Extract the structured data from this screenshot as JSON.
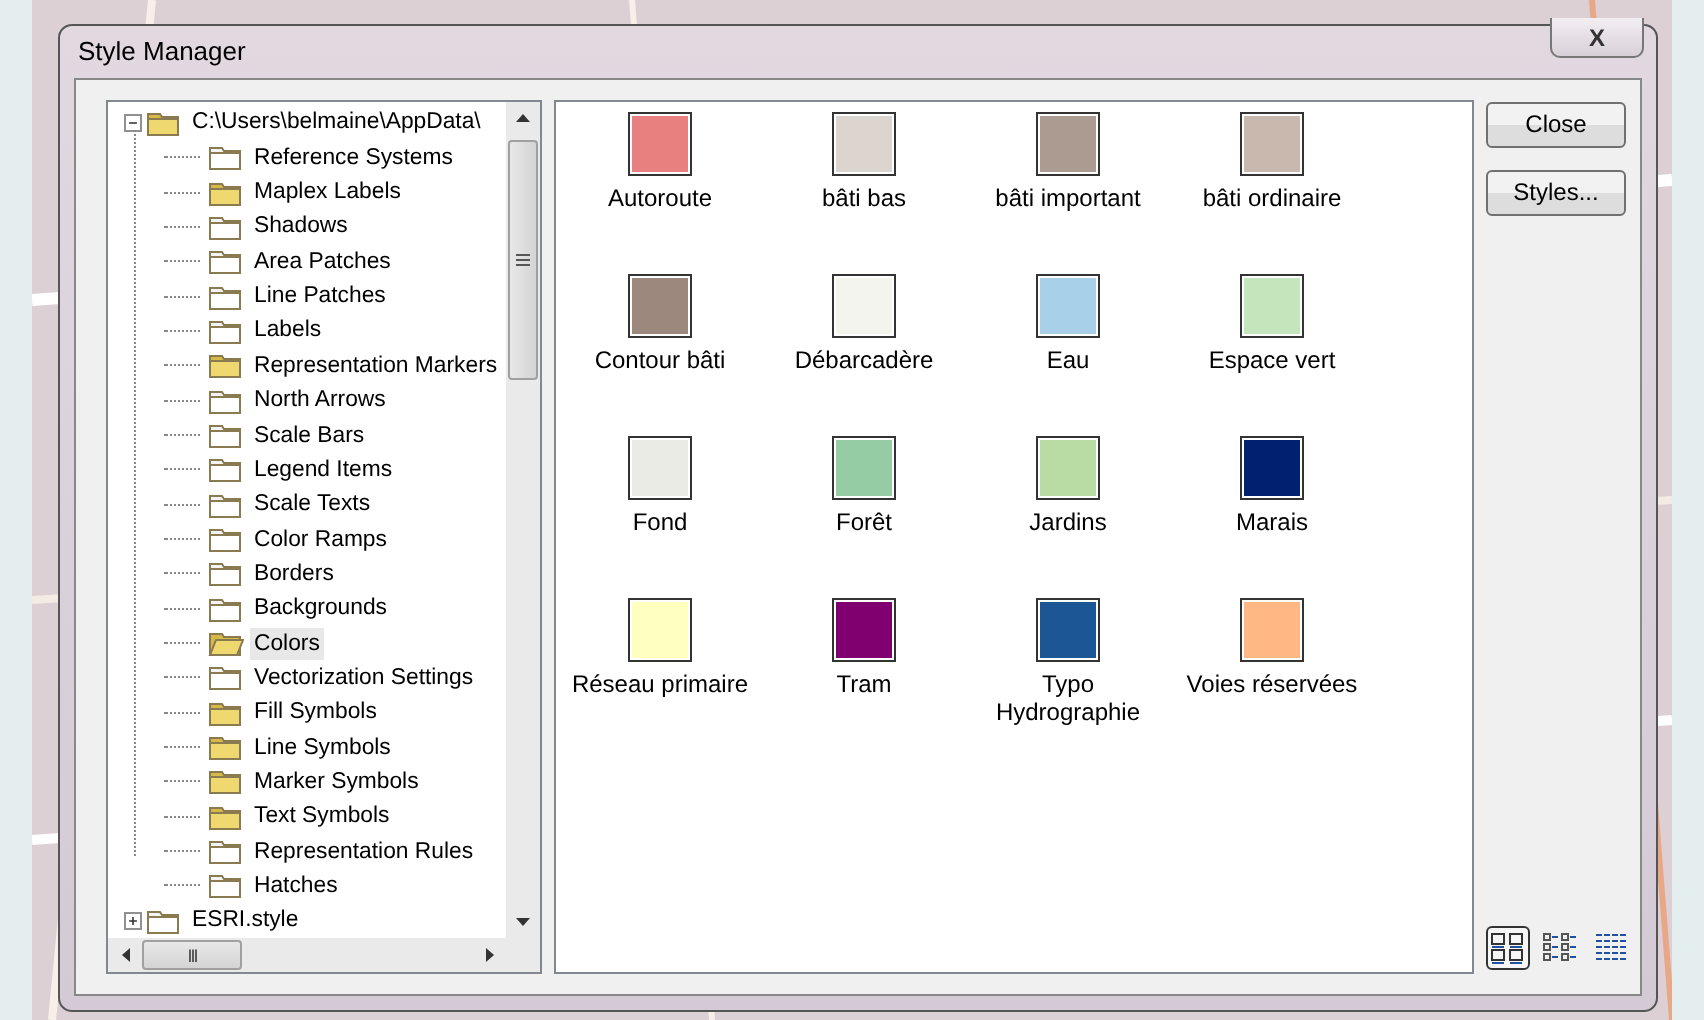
{
  "window": {
    "title": "Style Manager",
    "close_glyph": "X"
  },
  "tree": {
    "root": {
      "label": "C:\\Users\\belmaine\\AppData\\",
      "expanded": true,
      "has_items": true,
      "children": [
        {
          "label": "Reference Systems",
          "has_items": false,
          "selected": false
        },
        {
          "label": "Maplex Labels",
          "has_items": true,
          "selected": false
        },
        {
          "label": "Shadows",
          "has_items": false,
          "selected": false
        },
        {
          "label": "Area Patches",
          "has_items": false,
          "selected": false
        },
        {
          "label": "Line Patches",
          "has_items": false,
          "selected": false
        },
        {
          "label": "Labels",
          "has_items": false,
          "selected": false
        },
        {
          "label": "Representation Markers",
          "has_items": true,
          "selected": false
        },
        {
          "label": "North Arrows",
          "has_items": false,
          "selected": false
        },
        {
          "label": "Scale Bars",
          "has_items": false,
          "selected": false
        },
        {
          "label": "Legend Items",
          "has_items": false,
          "selected": false
        },
        {
          "label": "Scale Texts",
          "has_items": false,
          "selected": false
        },
        {
          "label": "Color Ramps",
          "has_items": false,
          "selected": false
        },
        {
          "label": "Borders",
          "has_items": false,
          "selected": false
        },
        {
          "label": "Backgrounds",
          "has_items": false,
          "selected": false
        },
        {
          "label": "Colors",
          "has_items": true,
          "selected": true
        },
        {
          "label": "Vectorization Settings",
          "has_items": false,
          "selected": false
        },
        {
          "label": "Fill Symbols",
          "has_items": true,
          "selected": false
        },
        {
          "label": "Line Symbols",
          "has_items": true,
          "selected": false
        },
        {
          "label": "Marker Symbols",
          "has_items": true,
          "selected": false
        },
        {
          "label": "Text Symbols",
          "has_items": true,
          "selected": false
        },
        {
          "label": "Representation Rules",
          "has_items": false,
          "selected": false
        },
        {
          "label": "Hatches",
          "has_items": false,
          "selected": false
        }
      ]
    },
    "next": {
      "label": "ESRI.style",
      "expanded": false
    }
  },
  "colors": [
    {
      "name": "Autoroute",
      "color": "#e88080"
    },
    {
      "name": "bâti bas",
      "color": "#dcd4ce"
    },
    {
      "name": "bâti important",
      "color": "#ab9b90"
    },
    {
      "name": "bâti ordinaire",
      "color": "#c8b8ae"
    },
    {
      "name": "Contour bâti",
      "color": "#9c887c"
    },
    {
      "name": "Débarcadère",
      "color": "#f4f4ee"
    },
    {
      "name": "Eau",
      "color": "#a8d0e8"
    },
    {
      "name": "Espace vert",
      "color": "#c4e6bc"
    },
    {
      "name": "Fond",
      "color": "#ebebe6"
    },
    {
      "name": "Forêt",
      "color": "#96cca4"
    },
    {
      "name": "Jardins",
      "color": "#b8dca4"
    },
    {
      "name": "Marais",
      "color": "#002070"
    },
    {
      "name": "Réseau primaire",
      "color": "#ffffc0"
    },
    {
      "name": "Tram",
      "color": "#800070"
    },
    {
      "name": "Typo Hydrographie",
      "color": "#1c5694"
    },
    {
      "name": "Voies réservées",
      "color": "#ffb884"
    }
  ],
  "buttons": [
    "Close",
    "Styles..."
  ],
  "view_modes": [
    {
      "kind": "large",
      "selected": true
    },
    {
      "kind": "list",
      "selected": false
    },
    {
      "kind": "details",
      "selected": false
    }
  ],
  "hscroll_glyph": "III"
}
